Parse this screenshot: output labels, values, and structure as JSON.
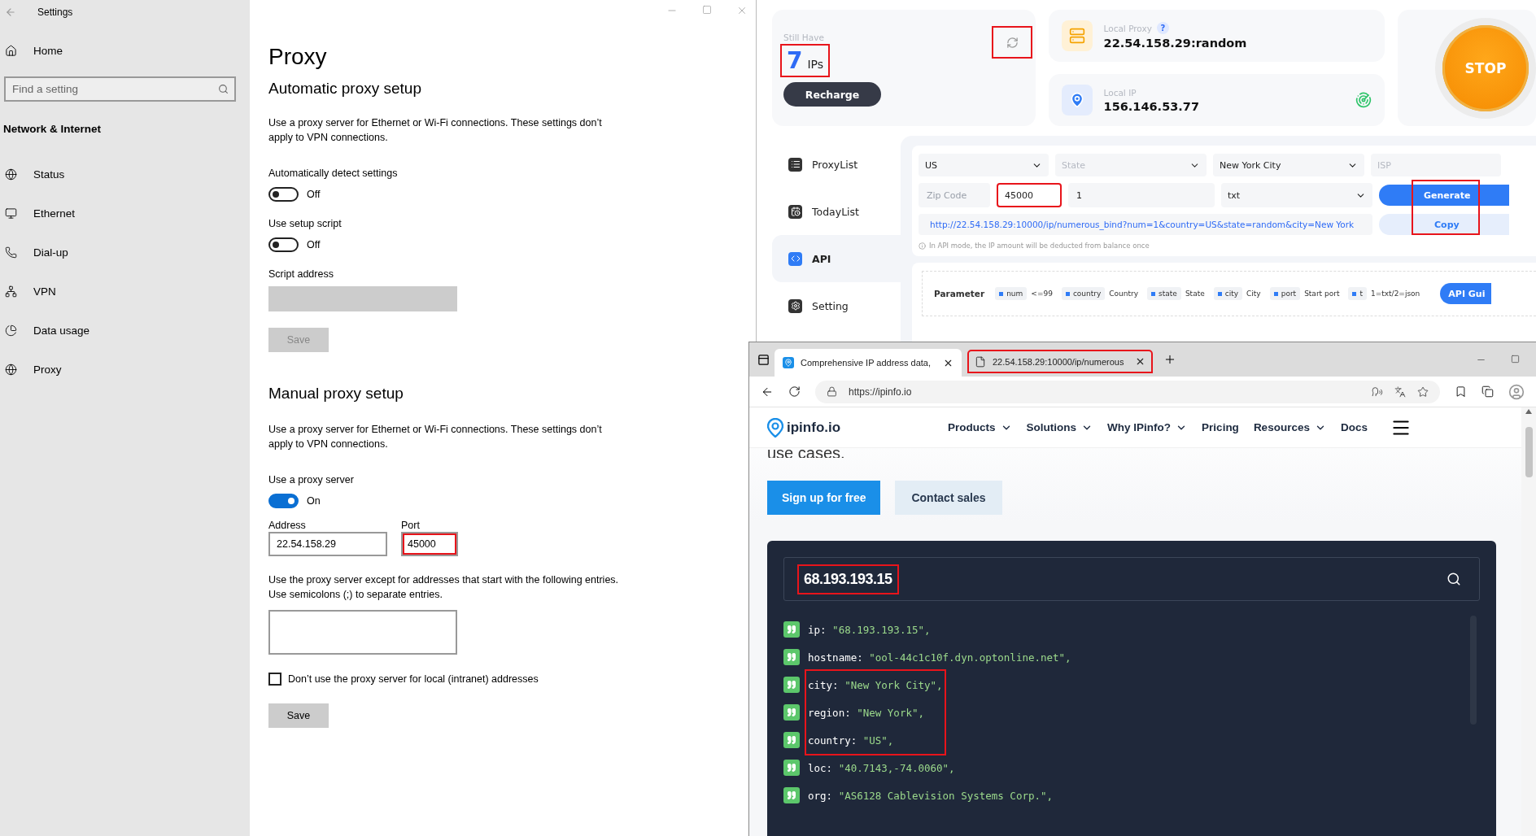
{
  "settings_window": {
    "title": "Settings",
    "sidebar": {
      "home": "Home",
      "search": {
        "placeholder": "Find a setting"
      },
      "section": "Network & Internet",
      "items": [
        {
          "label": "Status"
        },
        {
          "label": "Ethernet"
        },
        {
          "label": "Dial-up"
        },
        {
          "label": "VPN"
        },
        {
          "label": "Data usage"
        },
        {
          "label": "Proxy"
        }
      ]
    },
    "heading": "Proxy",
    "automatic": {
      "title": "Automatic proxy setup",
      "description": "Use a proxy server for Ethernet or Wi-Fi connections. These settings don’t apply to VPN connections.",
      "toggles": [
        {
          "label": "Automatically detect settings",
          "on": false,
          "state_text": "Off"
        },
        {
          "label": "Use setup script",
          "on": false,
          "state_text": "Off"
        }
      ],
      "script_address": {
        "label": "Script address",
        "disabled": true
      },
      "save": {
        "label": "Save",
        "disabled": true
      }
    },
    "manual": {
      "title": "Manual proxy setup",
      "description": "Use a proxy server for Ethernet or Wi-Fi connections. These settings don’t apply to VPN connections.",
      "toggle": {
        "label": "Use a proxy server",
        "on": true,
        "state_text": "On"
      },
      "address": {
        "label": "Address",
        "value": "22.54.158.29"
      },
      "port": {
        "label": "Port",
        "value": "45000",
        "highlighted": true
      },
      "exceptions": "Use the proxy server except for addresses that start with the following entries. Use semicolons (;) to separate entries.",
      "local_checkbox": {
        "label": "Don’t use the proxy server for local (intranet) addresses",
        "checked": false
      },
      "save": {
        "label": "Save",
        "disabled": false
      }
    }
  },
  "proxy_app": {
    "balance": {
      "caption": "Still Have",
      "count": "7",
      "unit": "IPs",
      "highlighted": true,
      "refresh_highlighted": true,
      "recharge": "Recharge"
    },
    "local_proxy": {
      "caption": "Local Proxy",
      "help": "?",
      "value": "22.54.158.29:random"
    },
    "local_ip": {
      "caption": "Local IP",
      "value": "156.146.53.77"
    },
    "stop": "STOP",
    "nav": [
      {
        "label": "ProxyList",
        "selected": false
      },
      {
        "label": "TodayList",
        "selected": false
      },
      {
        "label": "API",
        "selected": true
      },
      {
        "label": "Setting",
        "selected": false
      }
    ],
    "api": {
      "country": "US",
      "state": {
        "placeholder": "State"
      },
      "city": "New York City",
      "isp": {
        "placeholder": "ISP"
      },
      "zip": {
        "placeholder": "Zip Code"
      },
      "port": {
        "value": "45000",
        "highlighted": true
      },
      "count": "1",
      "format": "txt",
      "generate": "Generate",
      "copy": "Copy",
      "buttons_highlighted": true,
      "url": "http://22.54.158.29:10000/ip/numerous_bind?num=1&country=US&state=random&city=New York",
      "note": "In API mode, the IP amount will be deducted from balance once"
    },
    "parameters": {
      "title": "Parameter",
      "items": [
        {
          "name": "num",
          "description": "<=99"
        },
        {
          "name": "country",
          "description": "Country"
        },
        {
          "name": "state",
          "description": "State"
        },
        {
          "name": "city",
          "description": "City"
        },
        {
          "name": "port",
          "description": "Start port"
        },
        {
          "name": "t",
          "description": "1=txt/2=json"
        }
      ],
      "guide": "API Gui"
    }
  },
  "browser": {
    "tabs": [
      {
        "title": "Comprehensive IP address data,",
        "selected": true,
        "highlighted": false
      },
      {
        "title": "22.54.158.29:10000/ip/numerous",
        "selected": false,
        "highlighted": true
      }
    ],
    "address": "https://ipinfo.io",
    "site": {
      "logo": "ipinfo.io",
      "nav": [
        {
          "label": "Products",
          "dropdown": true
        },
        {
          "label": "Solutions",
          "dropdown": true
        },
        {
          "label": "Why IPinfo?",
          "dropdown": true
        },
        {
          "label": "Pricing",
          "dropdown": false
        },
        {
          "label": "Resources",
          "dropdown": true
        },
        {
          "label": "Docs",
          "dropdown": false
        }
      ],
      "partial_heading": "use cases.",
      "primary_button": "Sign up for free",
      "secondary_button": "Contact sales",
      "lookup": {
        "value": "68.193.193.15",
        "highlighted": true
      },
      "result_rows": [
        {
          "key": "ip:",
          "value": "\"68.193.193.15\",",
          "highlighted": false
        },
        {
          "key": "hostname:",
          "value": "\"ool-44c1c10f.dyn.optonline.net\",",
          "highlighted": false
        },
        {
          "key": "city:",
          "value": "\"New York City\",",
          "highlighted": true
        },
        {
          "key": "region:",
          "value": "\"New York\",",
          "highlighted": true
        },
        {
          "key": "country:",
          "value": "\"US\",",
          "highlighted": true
        },
        {
          "key": "loc:",
          "value": "\"40.7143,-74.0060\",",
          "highlighted": false
        },
        {
          "key": "org:",
          "value": "\"AS6128 Cablevision Systems Corp.\",",
          "highlighted": false
        }
      ]
    }
  }
}
